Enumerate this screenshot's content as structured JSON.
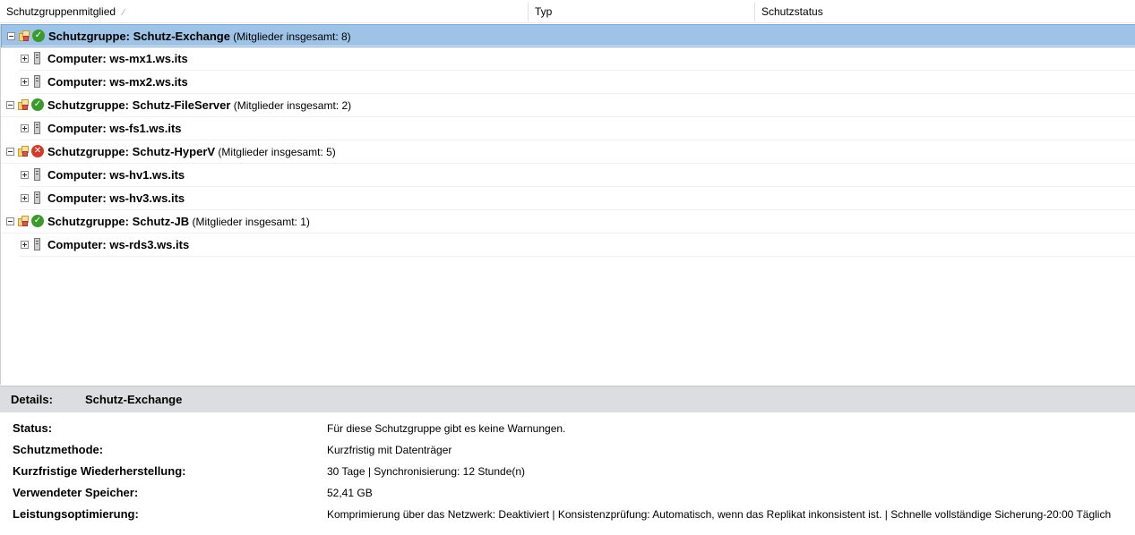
{
  "columns": [
    {
      "label": "Schutzgruppenmitglied"
    },
    {
      "label": "Typ"
    },
    {
      "label": "Schutzstatus"
    }
  ],
  "rows": [
    {
      "kind": "group",
      "prefix": "Schutzgruppe: ",
      "name": "Schutz-Exchange",
      "count": " (Mitglieder insgesamt: 8)",
      "status": "ok",
      "selected": true,
      "expanded": true
    },
    {
      "kind": "computer",
      "prefix": "Computer: ",
      "name": "ws-mx1.ws.its"
    },
    {
      "kind": "computer",
      "prefix": "Computer: ",
      "name": "ws-mx2.ws.its"
    },
    {
      "kind": "group",
      "prefix": "Schutzgruppe: ",
      "name": "Schutz-FileServer",
      "count": " (Mitglieder insgesamt: 2)",
      "status": "ok",
      "expanded": true
    },
    {
      "kind": "computer",
      "prefix": "Computer: ",
      "name": "ws-fs1.ws.its"
    },
    {
      "kind": "group",
      "prefix": "Schutzgruppe: ",
      "name": "Schutz-HyperV",
      "count": " (Mitglieder insgesamt: 5)",
      "status": "error",
      "expanded": true
    },
    {
      "kind": "computer",
      "prefix": "Computer: ",
      "name": "ws-hv1.ws.its"
    },
    {
      "kind": "computer",
      "prefix": "Computer: ",
      "name": "ws-hv3.ws.its"
    },
    {
      "kind": "group",
      "prefix": "Schutzgruppe: ",
      "name": "Schutz-JB",
      "count": " (Mitglieder insgesamt: 1)",
      "status": "ok",
      "expanded": true
    },
    {
      "kind": "computer",
      "prefix": "Computer: ",
      "name": "ws-rds3.ws.its"
    }
  ],
  "details": {
    "label": "Details:",
    "title": "Schutz-Exchange",
    "props": [
      {
        "key": "Status:",
        "value": "Für diese Schutzgruppe gibt es keine Warnungen."
      },
      {
        "key": "Schutzmethode:",
        "value": "Kurzfristig mit Datenträger"
      },
      {
        "key": "Kurzfristige Wiederherstellung:",
        "value": "30 Tage | Synchronisierung: 12 Stunde(n)"
      },
      {
        "key": "Verwendeter Speicher:",
        "value": "52,41 GB"
      },
      {
        "key": "Leistungsoptimierung:",
        "value": "Komprimierung über das Netzwerk: Deaktiviert | Konsistenzprüfung: Automatisch, wenn das Replikat inkonsistent ist. | Schnelle vollständige Sicherung-20:00 Täglich"
      }
    ]
  },
  "colors": {
    "selection": "#9ec3e6",
    "ok": "#3a9b2c",
    "error": "#d23a2a",
    "details_bar": "#dcdde0"
  },
  "icons": {
    "group": "protection-group-icon",
    "ok": "ok-check-icon",
    "error": "error-x-icon",
    "computer": "server-icon"
  }
}
